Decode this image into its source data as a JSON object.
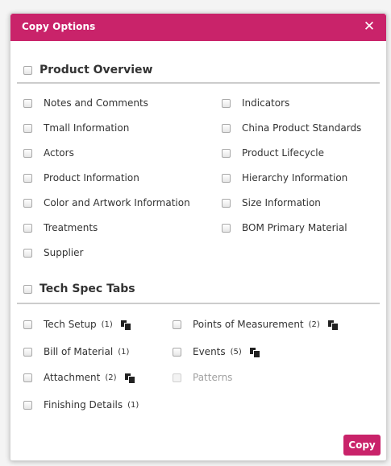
{
  "dialog": {
    "title": "Copy Options",
    "close_symbol": "✕",
    "copy_label": "Copy"
  },
  "product_overview": {
    "title": "Product Overview",
    "left": [
      "Notes and Comments",
      "Tmall Information",
      "Actors",
      "Product Information",
      "Color and Artwork Information",
      "Treatments",
      "Supplier"
    ],
    "right": [
      "Indicators",
      "China Product Standards",
      "Product Lifecycle",
      "Hierarchy Information",
      "Size Information",
      "BOM Primary Material"
    ]
  },
  "tech_spec": {
    "title": "Tech Spec Tabs",
    "left": [
      {
        "label": "Tech Setup",
        "count": "(1)",
        "copy_icon": true
      },
      {
        "label": "Bill of Material",
        "count": "(1)",
        "copy_icon": false
      },
      {
        "label": "Attachment",
        "count": "(2)",
        "copy_icon": true
      },
      {
        "label": "Finishing Details",
        "count": "(1)",
        "copy_icon": false
      }
    ],
    "right": [
      {
        "label": "Points of Measurement",
        "count": "(2)",
        "copy_icon": true
      },
      {
        "label": "Events",
        "count": "(5)",
        "copy_icon": true
      },
      {
        "label": "Patterns",
        "count": "",
        "copy_icon": false,
        "disabled": true
      }
    ]
  },
  "colors": {
    "accent": "#c9236a"
  }
}
